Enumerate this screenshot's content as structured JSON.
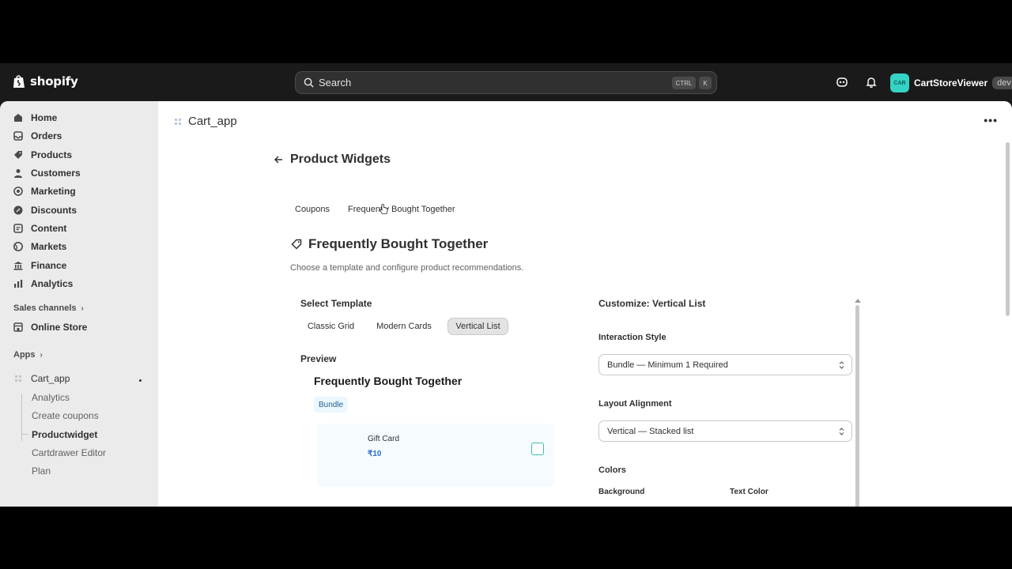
{
  "topbar": {
    "brand": "shopify",
    "search_placeholder": "Search",
    "shortcut_ctrl": "CTRL",
    "shortcut_k": "K",
    "store_avatar": "CAR",
    "store_name": "CartStoreViewer",
    "store_badge": "dev"
  },
  "sidebar": {
    "items": [
      {
        "label": "Home",
        "icon": "home-icon"
      },
      {
        "label": "Orders",
        "icon": "orders-icon"
      },
      {
        "label": "Products",
        "icon": "tag-icon"
      },
      {
        "label": "Customers",
        "icon": "person-icon"
      },
      {
        "label": "Marketing",
        "icon": "target-icon"
      },
      {
        "label": "Discounts",
        "icon": "discount-icon"
      },
      {
        "label": "Content",
        "icon": "content-icon"
      },
      {
        "label": "Markets",
        "icon": "globe-icon"
      },
      {
        "label": "Finance",
        "icon": "bank-icon"
      },
      {
        "label": "Analytics",
        "icon": "chart-icon"
      }
    ],
    "sales_channels_label": "Sales channels",
    "online_store": "Online Store",
    "apps_label": "Apps",
    "app_name": "Cart_app",
    "app_sub": [
      "Analytics",
      "Create coupons",
      "Productwidget",
      "Cartdrawer Editor",
      "Plan"
    ]
  },
  "main": {
    "app_title": "Cart_app",
    "page_title": "Product Widgets",
    "tabs": [
      "Coupons",
      "Frequently Bought Together"
    ],
    "section_title": "Frequently Bought Together",
    "section_desc": "Choose a template and configure product recommendations.",
    "select_template_label": "Select Template",
    "templates": [
      "Classic Grid",
      "Modern Cards",
      "Vertical List"
    ],
    "selected_template": "Vertical List",
    "preview_label": "Preview",
    "preview": {
      "title": "Frequently Bought Together",
      "badge": "Bundle",
      "item_name": "Gift Card",
      "item_price": "₹10"
    },
    "customize_title": "Customize: Vertical List",
    "interaction_label": "Interaction Style",
    "interaction_value": "Bundle — Minimum 1 Required",
    "layout_label": "Layout Alignment",
    "layout_value": "Vertical — Stacked list",
    "colors_label": "Colors",
    "background_label": "Background",
    "text_color_label": "Text Color"
  },
  "colors": {
    "accent_teal": "#35d3c4",
    "topbar_bg": "#1a1a1a",
    "link_blue": "#2c6ecb"
  }
}
